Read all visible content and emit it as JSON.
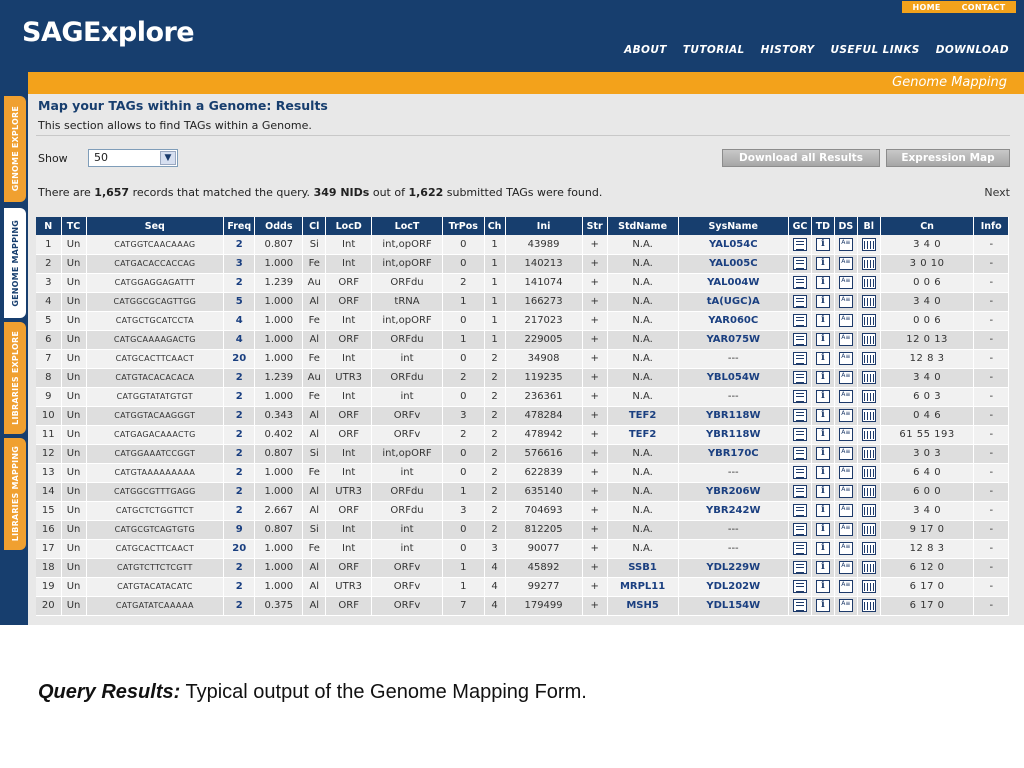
{
  "header": {
    "logo": "SAGExplore",
    "top_links": [
      "HOME",
      "CONTACT"
    ],
    "nav": [
      "ABOUT",
      "TUTORIAL",
      "HISTORY",
      "USEFUL LINKS",
      "DOWNLOAD"
    ]
  },
  "side_tabs": [
    "GENOME EXPLORE",
    "GENOME MAPPING",
    "LIBRARIES EXPLORE",
    "LIBRARIES MAPPING"
  ],
  "section_title": "Genome Mapping",
  "page": {
    "title": "Map your TAGs within a Genome: Results",
    "subtitle": "This section allows to find TAGs within a Genome.",
    "show_label": "Show",
    "show_value": "50",
    "download_button": "Download all Results",
    "expression_button": "Expression Map",
    "summary": {
      "p1": "There are ",
      "records": "1,657",
      "p2": " records that matched the query. ",
      "nids": "349 NIDs",
      "p3": " out of ",
      "submitted": "1,622",
      "p4": " submitted TAGs were found."
    },
    "next": "Next"
  },
  "table": {
    "columns": [
      "N",
      "TC",
      "Seq",
      "Freq",
      "Odds",
      "Cl",
      "LocD",
      "LocT",
      "TrPos",
      "Ch",
      "Ini",
      "Str",
      "StdName",
      "SysName",
      "GC",
      "TD",
      "DS",
      "Bl",
      "Cn",
      "Info"
    ],
    "rows": [
      [
        "1",
        "Un",
        "CATGGTCAACAAAG",
        "2",
        "0.807",
        "Si",
        "Int",
        "int,opORF",
        "0",
        "1",
        "43989",
        "+",
        "N.A.",
        "YAL054C",
        "3 4 0",
        "-"
      ],
      [
        "2",
        "Un",
        "CATGACACCACCAG",
        "3",
        "1.000",
        "Fe",
        "Int",
        "int,opORF",
        "0",
        "1",
        "140213",
        "+",
        "N.A.",
        "YAL005C",
        "3 0 10",
        "-"
      ],
      [
        "3",
        "Un",
        "CATGGAGGAGATTT",
        "2",
        "1.239",
        "Au",
        "ORF",
        "ORFdu",
        "2",
        "1",
        "141074",
        "+",
        "N.A.",
        "YAL004W",
        "0 0 6",
        "-"
      ],
      [
        "4",
        "Un",
        "CATGGCGCAGTTGG",
        "5",
        "1.000",
        "Al",
        "ORF",
        "tRNA",
        "1",
        "1",
        "166273",
        "+",
        "N.A.",
        "tA(UGC)A",
        "3 4 0",
        "-"
      ],
      [
        "5",
        "Un",
        "CATGCTGCATCCTA",
        "4",
        "1.000",
        "Fe",
        "Int",
        "int,opORF",
        "0",
        "1",
        "217023",
        "+",
        "N.A.",
        "YAR060C",
        "0 0 6",
        "-"
      ],
      [
        "6",
        "Un",
        "CATGCAAAAGACTG",
        "4",
        "1.000",
        "Al",
        "ORF",
        "ORFdu",
        "1",
        "1",
        "229005",
        "+",
        "N.A.",
        "YAR075W",
        "12 0 13",
        "-"
      ],
      [
        "7",
        "Un",
        "CATGCACTTCAACT",
        "20",
        "1.000",
        "Fe",
        "Int",
        "int",
        "0",
        "2",
        "34908",
        "+",
        "N.A.",
        "---",
        "12 8 3",
        "-"
      ],
      [
        "8",
        "Un",
        "CATGTACACACACA",
        "2",
        "1.239",
        "Au",
        "UTR3",
        "ORFdu",
        "2",
        "2",
        "119235",
        "+",
        "N.A.",
        "YBL054W",
        "3 4 0",
        "-"
      ],
      [
        "9",
        "Un",
        "CATGGTATATGTGT",
        "2",
        "1.000",
        "Fe",
        "Int",
        "int",
        "0",
        "2",
        "236361",
        "+",
        "N.A.",
        "---",
        "6 0 3",
        "-"
      ],
      [
        "10",
        "Un",
        "CATGGTACAAGGGT",
        "2",
        "0.343",
        "Al",
        "ORF",
        "ORFv",
        "3",
        "2",
        "478284",
        "+",
        "TEF2",
        "YBR118W",
        "0 4 6",
        "-"
      ],
      [
        "11",
        "Un",
        "CATGAGACAAACTG",
        "2",
        "0.402",
        "Al",
        "ORF",
        "ORFv",
        "2",
        "2",
        "478942",
        "+",
        "TEF2",
        "YBR118W",
        "61 55 193",
        "-"
      ],
      [
        "12",
        "Un",
        "CATGGAAATCCGGT",
        "2",
        "0.807",
        "Si",
        "Int",
        "int,opORF",
        "0",
        "2",
        "576616",
        "+",
        "N.A.",
        "YBR170C",
        "3 0 3",
        "-"
      ],
      [
        "13",
        "Un",
        "CATGTAAAAAAAAA",
        "2",
        "1.000",
        "Fe",
        "Int",
        "int",
        "0",
        "2",
        "622839",
        "+",
        "N.A.",
        "---",
        "6 4 0",
        "-"
      ],
      [
        "14",
        "Un",
        "CATGGCGTTTGAGG",
        "2",
        "1.000",
        "Al",
        "UTR3",
        "ORFdu",
        "1",
        "2",
        "635140",
        "+",
        "N.A.",
        "YBR206W",
        "6 0 0",
        "-"
      ],
      [
        "15",
        "Un",
        "CATGCTCTGGTTCT",
        "2",
        "2.667",
        "Al",
        "ORF",
        "ORFdu",
        "3",
        "2",
        "704693",
        "+",
        "N.A.",
        "YBR242W",
        "3 4 0",
        "-"
      ],
      [
        "16",
        "Un",
        "CATGCGTCAGTGTG",
        "9",
        "0.807",
        "Si",
        "Int",
        "int",
        "0",
        "2",
        "812205",
        "+",
        "N.A.",
        "---",
        "9 17 0",
        "-"
      ],
      [
        "17",
        "Un",
        "CATGCACTTCAACT",
        "20",
        "1.000",
        "Fe",
        "Int",
        "int",
        "0",
        "3",
        "90077",
        "+",
        "N.A.",
        "---",
        "12 8 3",
        "-"
      ],
      [
        "18",
        "Un",
        "CATGTCTTCTCGTT",
        "2",
        "1.000",
        "Al",
        "ORF",
        "ORFv",
        "1",
        "4",
        "45892",
        "+",
        "SSB1",
        "YDL229W",
        "6 12 0",
        "-"
      ],
      [
        "19",
        "Un",
        "CATGTACATACATC",
        "2",
        "1.000",
        "Al",
        "UTR3",
        "ORFv",
        "1",
        "4",
        "99277",
        "+",
        "MRPL11",
        "YDL202W",
        "6 17 0",
        "-"
      ],
      [
        "20",
        "Un",
        "CATGATATCAAAAA",
        "2",
        "0.375",
        "Al",
        "ORF",
        "ORFv",
        "7",
        "4",
        "179499",
        "+",
        "MSH5",
        "YDL154W",
        "6 17 0",
        "-"
      ]
    ]
  },
  "caption": {
    "label": "Query Results:",
    "text": " Typical output of the Genome Mapping Form."
  }
}
